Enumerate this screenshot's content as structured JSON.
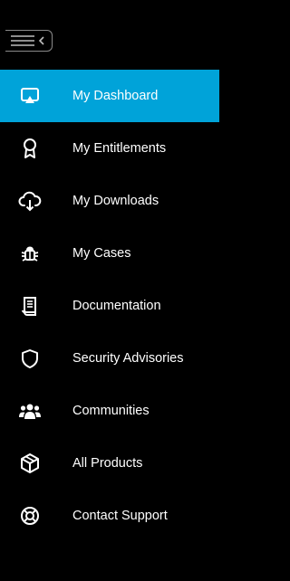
{
  "sidebar": {
    "toggle_icon": "menu-collapse-icon",
    "active_color": "#00a3d9",
    "items": [
      {
        "label": "My Dashboard",
        "icon": "dashboard-icon",
        "active": true
      },
      {
        "label": "My Entitlements",
        "icon": "award-icon",
        "active": false
      },
      {
        "label": "My Downloads",
        "icon": "cloud-download-icon",
        "active": false
      },
      {
        "label": "My Cases",
        "icon": "bug-icon",
        "active": false
      },
      {
        "label": "Documentation",
        "icon": "document-icon",
        "active": false
      },
      {
        "label": "Security Advisories",
        "icon": "shield-icon",
        "active": false
      },
      {
        "label": "Communities",
        "icon": "users-icon",
        "active": false
      },
      {
        "label": "All Products",
        "icon": "products-icon",
        "active": false
      },
      {
        "label": "Contact Support",
        "icon": "lifebuoy-icon",
        "active": false
      }
    ]
  }
}
